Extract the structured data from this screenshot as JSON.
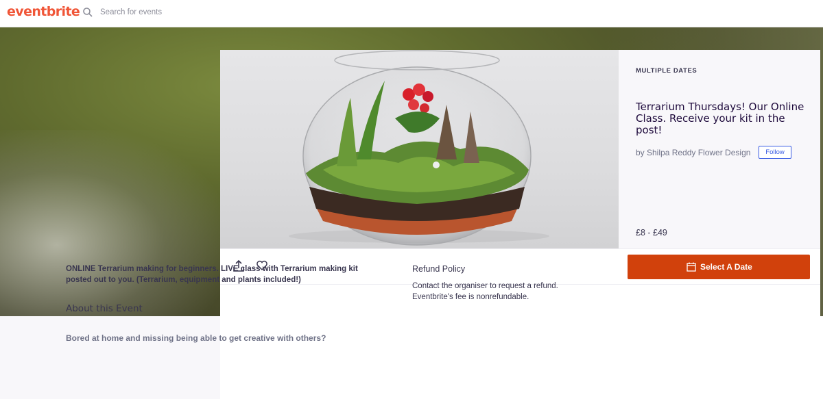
{
  "brand": {
    "logo": "eventbrite"
  },
  "search": {
    "placeholder": "Search for events"
  },
  "event": {
    "dates_label": "MULTIPLE DATES",
    "title": "Terrarium Thursdays! Our Online Class. Receive your kit in the post!",
    "organizer": "by Shilpa Reddy Flower Design",
    "follow_label": "Follow",
    "price": "£8 - £49",
    "cta_label": "Select A Date",
    "summary": "ONLINE Terrarium making for beginners. LIVE class with Terrarium making kit posted out to you. (Terrarium, equipment and plants included!)",
    "about_heading": "About this Event",
    "about_first_line": "Bored at home and missing being able to get creative with others?"
  },
  "refund": {
    "heading": "Refund Policy",
    "text": "Contact the organiser to request a refund. Eventbrite's fee is nonrefundable."
  },
  "icons": [
    "search-icon",
    "share-icon",
    "heart-icon",
    "calendar-icon"
  ],
  "colors": {
    "brand": "#f05537",
    "cta": "#d1410c",
    "follow": "#3659e3",
    "heading": "#1e0a3c"
  }
}
